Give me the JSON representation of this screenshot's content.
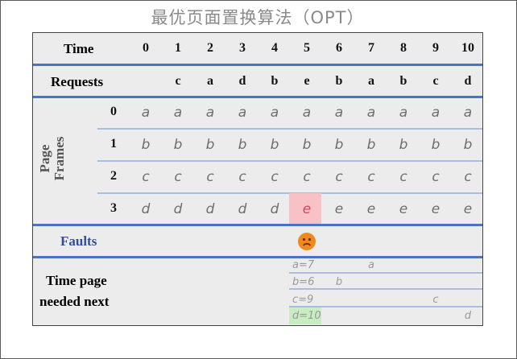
{
  "title": "最优页面置换算法（OPT）",
  "labels": {
    "time": "Time",
    "requests": "Requests",
    "page_frames_line1": "Page",
    "page_frames_line2": "Frames",
    "faults": "Faults",
    "needed_next_line1": "Time page",
    "needed_next_line2": "needed next"
  },
  "times": [
    "0",
    "1",
    "2",
    "3",
    "4",
    "5",
    "6",
    "7",
    "8",
    "9",
    "10"
  ],
  "requests": [
    "",
    "c",
    "a",
    "d",
    "b",
    "e",
    "b",
    "a",
    "b",
    "c",
    "d"
  ],
  "frame_ids": [
    "0",
    "1",
    "2",
    "3"
  ],
  "frames": [
    [
      "a",
      "a",
      "a",
      "a",
      "a",
      "a",
      "a",
      "a",
      "a",
      "a",
      "a"
    ],
    [
      "b",
      "b",
      "b",
      "b",
      "b",
      "b",
      "b",
      "b",
      "b",
      "b",
      "b"
    ],
    [
      "c",
      "c",
      "c",
      "c",
      "c",
      "c",
      "c",
      "c",
      "c",
      "c",
      "c"
    ],
    [
      "d",
      "d",
      "d",
      "d",
      "d",
      "e",
      "e",
      "e",
      "e",
      "e",
      "e"
    ]
  ],
  "fault_at_time": "5",
  "fault_icon": "sad-face-icon",
  "replaced_cell": {
    "frame": "3",
    "time": "5",
    "value": "e"
  },
  "next_needed": {
    "rows": [
      {
        "text": "a=7",
        "marker": "a"
      },
      {
        "text": "b=6",
        "marker": "b"
      },
      {
        "text": "c=9",
        "marker": "c"
      },
      {
        "text": "d=10",
        "marker": "d"
      }
    ]
  },
  "colors": {
    "accent_line": "#4a74bf",
    "thin_line": "#a9bde3",
    "replace_highlight": "#f7c1c6",
    "victim_highlight": "#c9ecc2",
    "fault_icon": "#f08a1a"
  }
}
